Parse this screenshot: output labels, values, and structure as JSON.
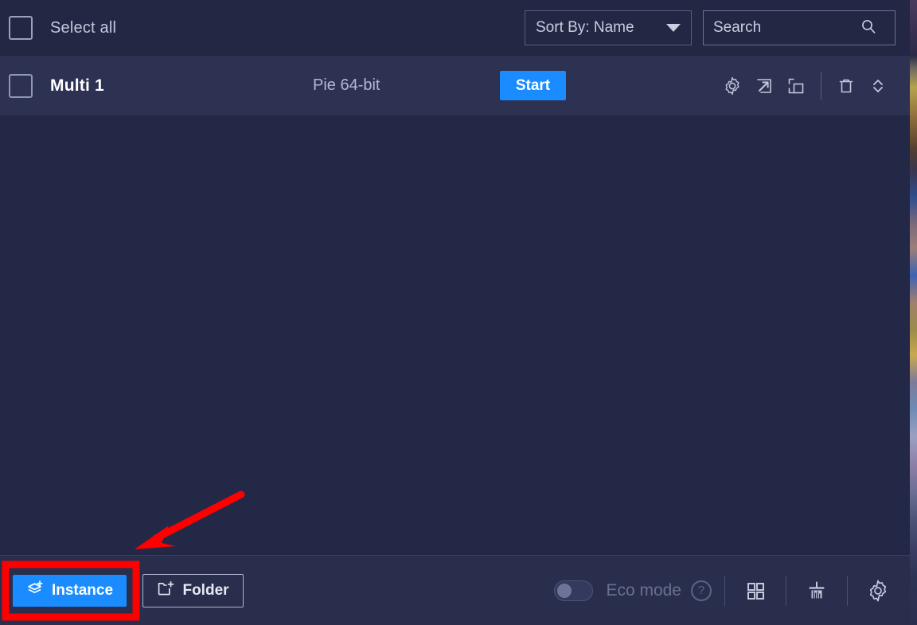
{
  "header": {
    "select_all_label": "Select all",
    "select_all_checked": false,
    "sort": {
      "label": "Sort By: Name",
      "caret_icon": "chevron-down-icon"
    },
    "search": {
      "value": "",
      "placeholder": "Search",
      "icon": "search-icon"
    }
  },
  "instances": [
    {
      "checked": false,
      "name": "Multi 1",
      "os": "Pie 64-bit",
      "start_label": "Start",
      "actions": [
        {
          "name": "settings",
          "icon": "gear-icon"
        },
        {
          "name": "shortcut",
          "icon": "open-shortcut-arrow-icon"
        },
        {
          "name": "clone",
          "icon": "clone-copy-icon"
        },
        {
          "name": "delete",
          "icon": "trash-icon"
        },
        {
          "name": "reorder",
          "icon": "chevron-up-down-icon"
        }
      ]
    }
  ],
  "footer": {
    "instance_button": {
      "label": "Instance",
      "icon": "stack-plus-icon"
    },
    "folder_button": {
      "label": "Folder",
      "icon": "folder-plus-icon"
    },
    "eco_mode": {
      "label": "Eco mode",
      "enabled": false,
      "help_icon": "question-mark-icon"
    },
    "tools": [
      {
        "name": "grid-view",
        "icon": "grid-view-icon"
      },
      {
        "name": "disk-cleanup",
        "icon": "broom-cleanup-icon"
      },
      {
        "name": "preferences",
        "icon": "gear-icon"
      }
    ]
  },
  "annotations": {
    "highlight_box": {
      "shape": "rectangle",
      "color": "#ff0000",
      "target": "instance-button"
    },
    "arrow": {
      "shape": "arrow",
      "color": "#ff0000",
      "points_to": "instance-button"
    }
  },
  "colors": {
    "accent_blue": "#1a8cff",
    "panel_bg": "#242847",
    "header_bg": "#232743",
    "row_bg": "#2d3152",
    "footer_bg": "#2a2e4d",
    "annotation_red": "#ff0000"
  }
}
